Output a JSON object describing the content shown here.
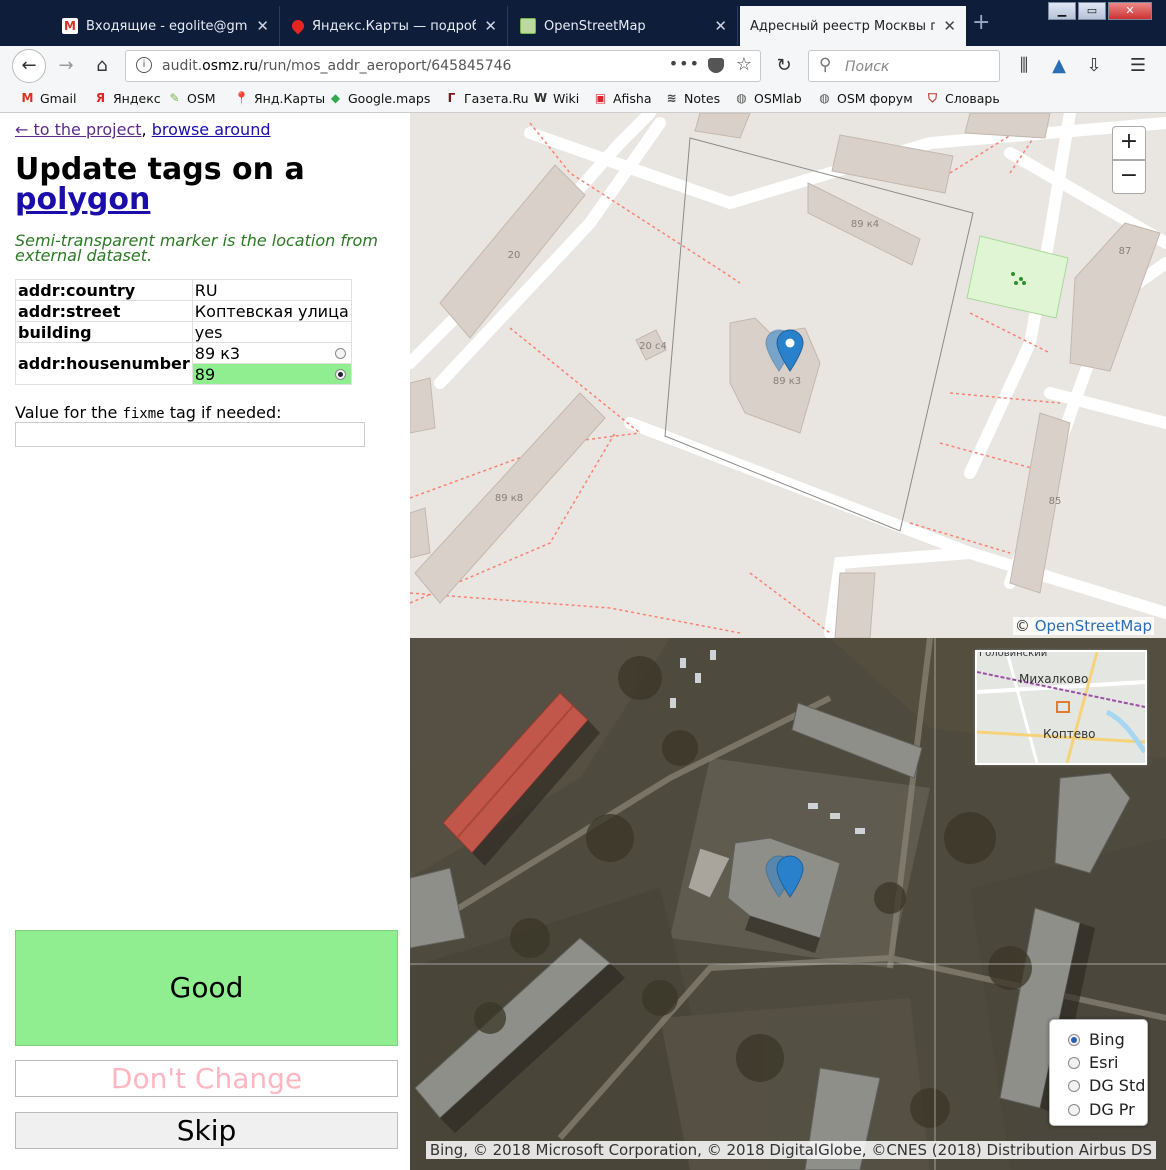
{
  "browser": {
    "tabs": [
      {
        "label": "Входящие - egolite@gmail.",
        "icon": "gmail-icon",
        "active": false
      },
      {
        "label": "Яндекс.Карты — подробна",
        "icon": "yandex-maps-icon",
        "active": false
      },
      {
        "label": "OpenStreetMap",
        "icon": "osm-icon",
        "active": false
      },
      {
        "label": "Адресный реестр Москвы по С",
        "icon": "page-icon",
        "active": true
      }
    ],
    "url_prefix": "audit.",
    "url_domain": "osmz.ru",
    "url_path": "/run/mos_addr_aeroport/645845746",
    "search_placeholder": "Поиск",
    "bookmarks": [
      {
        "label": "Gmail",
        "icon": "gmail-icon",
        "glyph": "M",
        "color": "#d93025"
      },
      {
        "label": "Яндекс",
        "icon": "yandex-icon",
        "glyph": "Я",
        "color": "#e52620"
      },
      {
        "label": "OSM",
        "icon": "osm-icon",
        "glyph": "✎",
        "color": "#7ab648"
      },
      {
        "label": "Янд.Карты",
        "icon": "pin-icon",
        "glyph": "📍",
        "color": "#e52620"
      },
      {
        "label": "Google.maps",
        "icon": "google-maps-icon",
        "glyph": "◆",
        "color": "#34a853"
      },
      {
        "label": "Газета.Ru",
        "icon": "gazeta-icon",
        "glyph": "Г",
        "color": "#7a1420"
      },
      {
        "label": "Wiki",
        "icon": "wiki-icon",
        "glyph": "W",
        "color": "#333333"
      },
      {
        "label": "Afisha",
        "icon": "afisha-icon",
        "glyph": "▣",
        "color": "#d9262c"
      },
      {
        "label": "Notes",
        "icon": "rss-icon",
        "glyph": "≋",
        "color": "#444444"
      },
      {
        "label": "OSMlab",
        "icon": "globe-icon",
        "glyph": "◍",
        "color": "#555555"
      },
      {
        "label": "OSM форум",
        "icon": "globe-icon",
        "glyph": "◍",
        "color": "#555555"
      },
      {
        "label": "Словарь",
        "icon": "shield-icon",
        "glyph": "⛉",
        "color": "#c0392b"
      }
    ]
  },
  "panel": {
    "back_link": "← to the project",
    "separator": ",",
    "browse_link": "browse around",
    "heading_line1": "Update tags on a",
    "heading_line2": "polygon",
    "hint": "Semi-transparent marker is the location from external dataset.",
    "tags": [
      {
        "key": "addr:country",
        "value": "RU"
      },
      {
        "key": "addr:street",
        "value": "Коптевская улица"
      },
      {
        "key": "building",
        "value": "yes"
      }
    ],
    "housenumber": {
      "key": "addr:housenumber",
      "options": [
        {
          "value": "89 к3",
          "selected": false
        },
        {
          "value": "89",
          "selected": true
        }
      ]
    },
    "fixme_label_before": "Value for the ",
    "fixme_tag": "fixme",
    "fixme_label_after": " tag if needed:",
    "fixme_value": "",
    "buttons": {
      "good": "Good",
      "dont_change": "Don't Change",
      "skip": "Skip"
    }
  },
  "osm_map": {
    "zoom_in": "+",
    "zoom_out": "−",
    "attribution_prefix": "©",
    "attribution_link": "OpenStreetMap",
    "labels": {
      "b20": "20",
      "b20c4": "20 с4",
      "b89k4": "89 к4",
      "b89k3": "89 к3",
      "b89k8": "89 к8",
      "b87": "87",
      "b85": "85"
    }
  },
  "satellite": {
    "minimap_labels": {
      "top": "Головинский",
      "mid": "Михалково",
      "bottom": "Коптево"
    },
    "layers": [
      {
        "label": "Bing",
        "selected": true
      },
      {
        "label": "Esri",
        "selected": false
      },
      {
        "label": "DG Std",
        "selected": false
      },
      {
        "label": "DG Pr",
        "selected": false
      }
    ],
    "attribution": "Bing, © 2018 Microsoft Corporation, © 2018 DigitalGlobe, ©CNES (2018) Distribution Airbus DS"
  },
  "colors": {
    "building_fill": "#d9d0c9",
    "footway": "#fa8072",
    "green_area": "#cdebb0",
    "marker": "#2a81cb",
    "good_button": "#90ee90"
  }
}
